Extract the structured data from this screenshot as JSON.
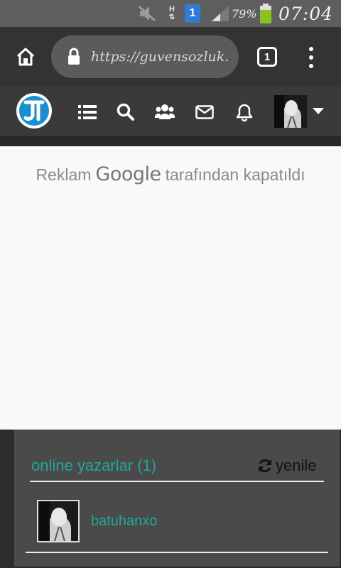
{
  "status_bar": {
    "network_type": "H",
    "sim_slot": "1",
    "battery_percent": "79%",
    "time": "07:04",
    "icons": [
      "mute-icon",
      "data-arrows-icon",
      "sim-icon",
      "signal-icon",
      "battery-icon"
    ],
    "battery_color": "#8cc220"
  },
  "browser": {
    "url": "https://guvensozluk.c",
    "tab_count": "1",
    "icons": [
      "home-icon",
      "lock-icon",
      "tab-switcher-icon",
      "overflow-menu-icon"
    ]
  },
  "site_nav": {
    "logo": "logo-icon",
    "icons": [
      "list-icon",
      "search-icon",
      "users-icon",
      "mail-icon",
      "bell-icon",
      "avatar",
      "caret-down-icon"
    ],
    "brand_color": "#1a8fd0"
  },
  "ad": {
    "prefix": "Reklam",
    "brand": "Google",
    "suffix": "tarafından kapatıldı"
  },
  "online_panel": {
    "title": "online yazarlar (1)",
    "refresh_label": "yenile",
    "accent_color": "#1fa99a",
    "users": [
      {
        "username": "batuhanxo"
      }
    ]
  }
}
